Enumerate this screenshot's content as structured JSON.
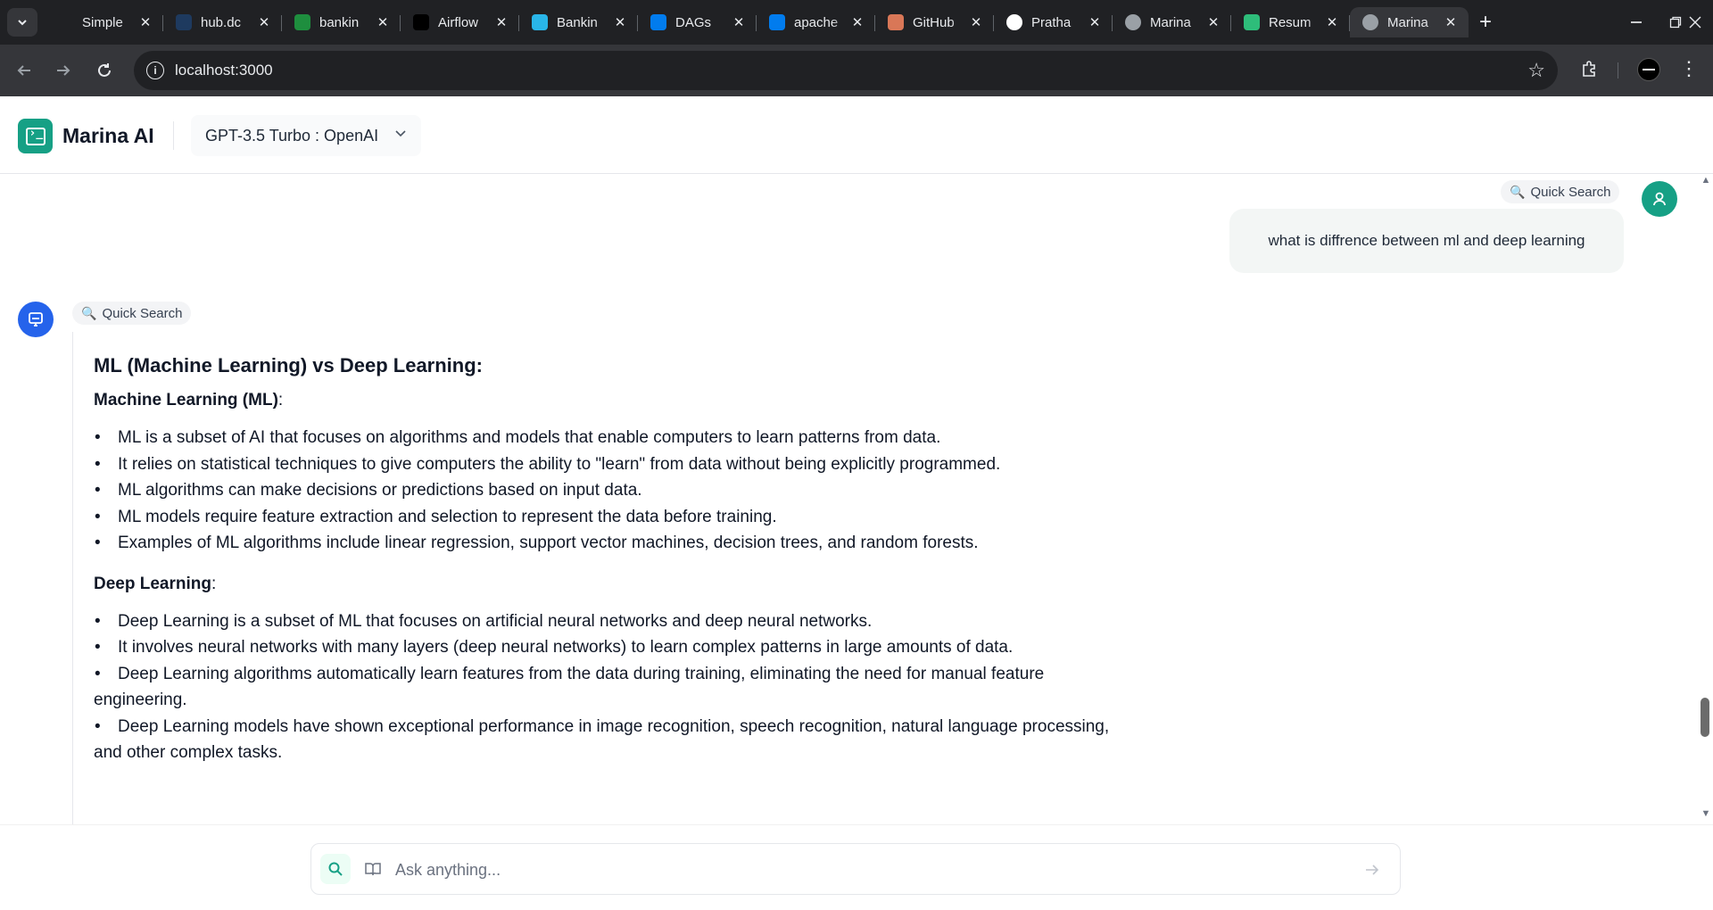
{
  "browser": {
    "tabs": [
      {
        "title": "Simple",
        "icon": "openai-icon",
        "color": "#202124"
      },
      {
        "title": "hub.dc",
        "icon": "hub-icon",
        "color": "#1e3a5f"
      },
      {
        "title": "bankin",
        "icon": "sheet-icon",
        "color": "#1e8e3e"
      },
      {
        "title": "Airflow",
        "icon": "medium-icon",
        "color": "#000000"
      },
      {
        "title": "Bankin",
        "icon": "snowflake-icon",
        "color": "#29b5e8"
      },
      {
        "title": "DAGs",
        "icon": "airflow-icon",
        "color": "#017cee"
      },
      {
        "title": "apache",
        "icon": "airflow-icon",
        "color": "#017cee"
      },
      {
        "title": "GitHub",
        "icon": "claude-icon",
        "color": "#d97757"
      },
      {
        "title": "Pratha",
        "icon": "github-icon",
        "color": "#ffffff"
      },
      {
        "title": "Marina",
        "icon": "globe-icon",
        "color": "#9aa0a6"
      },
      {
        "title": "Resum",
        "icon": "resume-icon",
        "color": "#2ebd7a"
      },
      {
        "title": "Marina",
        "icon": "globe-icon",
        "color": "#9aa0a6",
        "active": true
      }
    ],
    "url": "localhost:3000"
  },
  "app": {
    "name": "Marina AI",
    "model": "GPT-3.5 Turbo : OpenAI"
  },
  "chat": {
    "user_badge": "Quick Search",
    "user_message": "what is diffrence between ml and deep learning",
    "bot_badge": "Quick Search",
    "answer": {
      "heading": "ML (Machine Learning) vs Deep Learning:",
      "sections": [
        {
          "title": "Machine Learning (ML)",
          "bullets": [
            "ML is a subset of AI that focuses on algorithms and models that enable computers to learn patterns from data.",
            "It relies on statistical techniques to give computers the ability to \"learn\" from data without being explicitly programmed.",
            "ML algorithms can make decisions or predictions based on input data.",
            "ML models require feature extraction and selection to represent the data before training.",
            "Examples of ML algorithms include linear regression, support vector machines, decision trees, and random forests."
          ]
        },
        {
          "title": "Deep Learning",
          "bullets": [
            "Deep Learning is a subset of ML that focuses on artificial neural networks and deep neural networks.",
            "It involves neural networks with many layers (deep neural networks) to learn complex patterns in large amounts of data.",
            "Deep Learning algorithms automatically learn features from the data during training, eliminating the need for manual feature engineering.",
            "Deep Learning models have shown exceptional performance in image recognition, speech recognition, natural language processing, and other complex tasks."
          ]
        }
      ]
    }
  },
  "composer": {
    "placeholder": "Ask anything..."
  },
  "colors": {
    "accent": "#16a085",
    "bot": "#2563eb"
  }
}
